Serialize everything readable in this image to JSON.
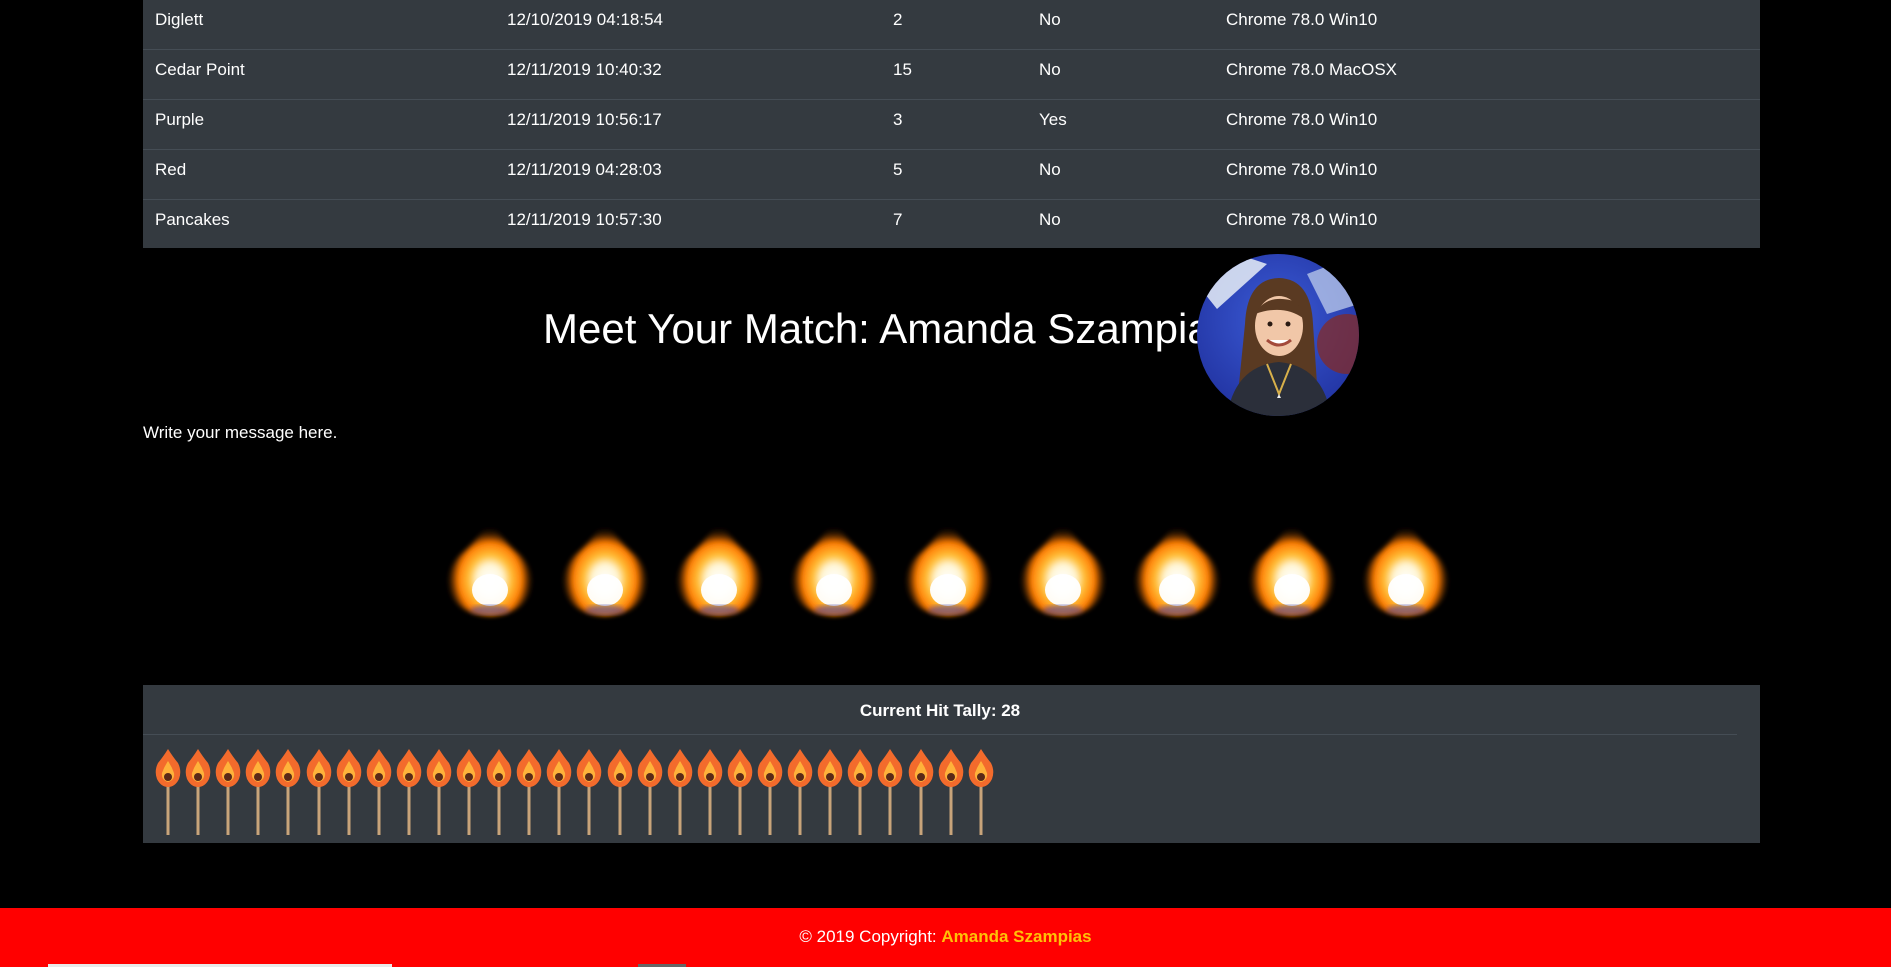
{
  "table": {
    "rows": [
      {
        "name": "Diglett",
        "date": "12/10/2019 04:18:54",
        "count": "2",
        "flag": "No",
        "browser": "Chrome 78.0 Win10"
      },
      {
        "name": "Cedar Point",
        "date": "12/11/2019 10:40:32",
        "count": "15",
        "flag": "No",
        "browser": "Chrome 78.0 MacOSX"
      },
      {
        "name": "Purple",
        "date": "12/11/2019 10:56:17",
        "count": "3",
        "flag": "Yes",
        "browser": "Chrome 78.0 Win10"
      },
      {
        "name": "Red",
        "date": "12/11/2019 04:28:03",
        "count": "5",
        "flag": "No",
        "browser": "Chrome 78.0 Win10"
      },
      {
        "name": "Pancakes",
        "date": "12/11/2019 10:57:30",
        "count": "7",
        "flag": "No",
        "browser": "Chrome 78.0 Win10"
      }
    ]
  },
  "match": {
    "title": "Meet Your Match: Amanda Szampias",
    "avatar_icon": "profile-photo"
  },
  "message": "Write your message here.",
  "flames": {
    "count": 9,
    "icon": "flame-icon"
  },
  "tally": {
    "label": "Current Hit Tally: 28",
    "value": 28,
    "icon": "match-stick-icon"
  },
  "footer": {
    "prefix": "© 2019 Copyright: ",
    "author": "Amanda Szampias"
  },
  "colors": {
    "table_bg": "#343a40",
    "footer_bg": "#ff0000",
    "author_color": "#ffc107"
  }
}
